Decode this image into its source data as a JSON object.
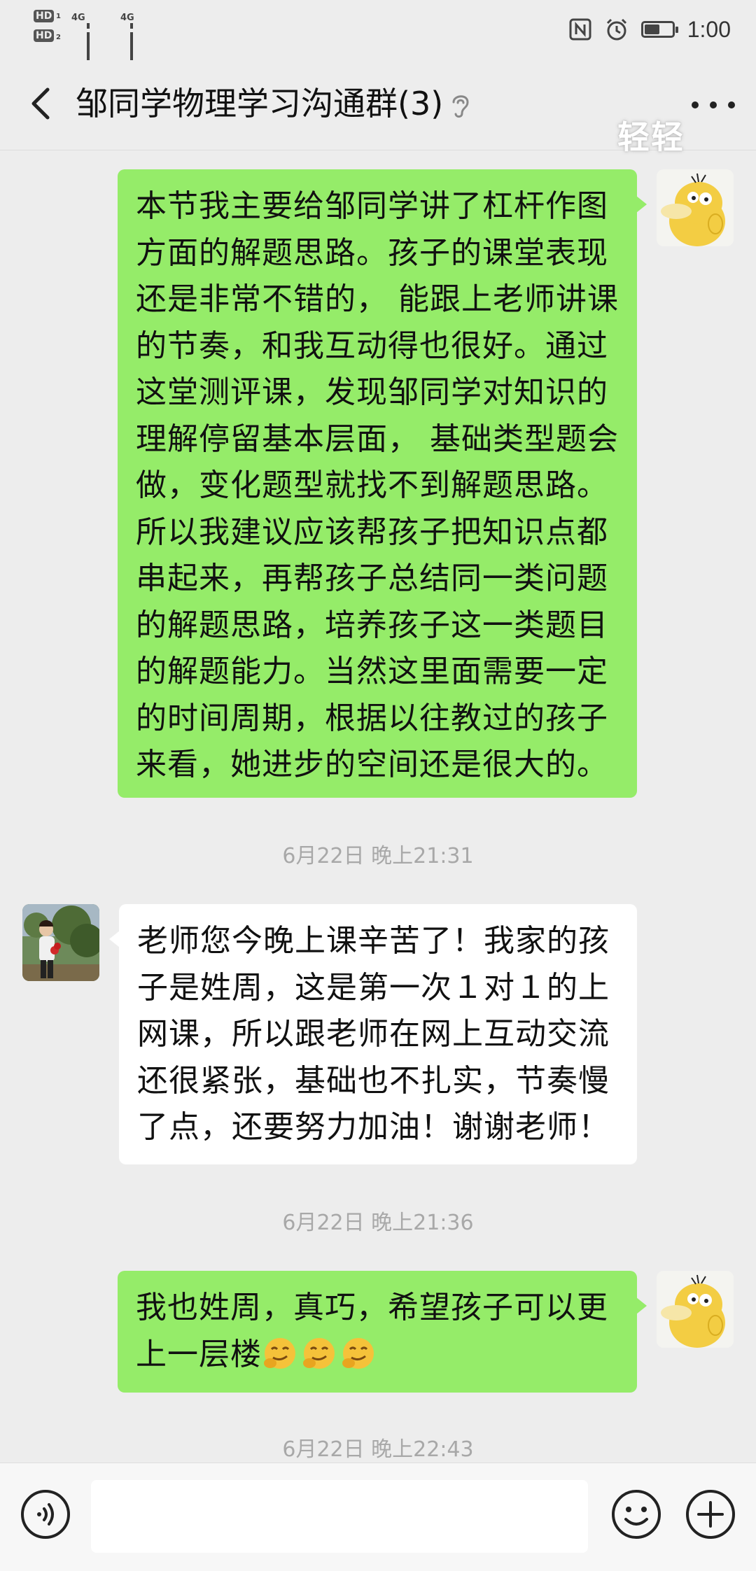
{
  "status_bar": {
    "sim1_badge": "HD",
    "sim1_index": "1",
    "sim2_badge": "HD",
    "sim2_index": "2",
    "net1": "4G",
    "net2": "4G",
    "time": "1:00",
    "battery_level": 0.55,
    "icons": [
      "nfc-icon",
      "alarm-icon",
      "battery-icon"
    ]
  },
  "header": {
    "title": "邹同学物理学习沟通群(3)",
    "icons": [
      "back-arrow-icon",
      "earpiece-icon",
      "more-dots-icon"
    ]
  },
  "watermark": "轻轻",
  "messages": [
    {
      "direction": "sent",
      "text": "本节我主要给邹同学讲了杠杆作图方面的解题思路。孩子的课堂表现还是非常不错的，  能跟上老师讲课的节奏，和我互动得也很好。通过这堂测评课，发现邹同学对知识的理解停留基本层面，  基础类型题会做，变化题型就找不到解题思路。所以我建议应该帮孩子把知识点都串起来，再帮孩子总结同一类问题的解题思路，培养孩子这一类题目的解题能力。当然这里面需要一定的时间周期，根据以往教过的孩子来看，她进步的空间还是很大的。",
      "avatar": "duck-avatar"
    },
    {
      "type": "timestamp",
      "text": "6月22日 晚上21:31"
    },
    {
      "direction": "received",
      "text": "老师您今晚上课辛苦了！我家的孩子是姓周，这是第一次１对１的上网课，所以跟老师在网上互动交流还很紧张，基础也不扎实，节奏慢了点，还要努力加油！谢谢老师！",
      "avatar": "parent-photo-avatar"
    },
    {
      "type": "timestamp",
      "text": "6月22日 晚上21:36"
    },
    {
      "direction": "sent",
      "text": "我也姓周，真巧，希望孩子可以更上一层楼",
      "emojis": [
        "smirk-emoji",
        "smirk-emoji",
        "smirk-emoji"
      ],
      "avatar": "duck-avatar"
    },
    {
      "type": "timestamp",
      "text": "6月22日 晚上22:43"
    }
  ],
  "input_bar": {
    "placeholder": "",
    "icons": [
      "voice-icon",
      "emoji-face-icon",
      "plus-icon"
    ]
  },
  "colors": {
    "background": "#ededed",
    "sent_bubble": "#95ec69",
    "received_bubble": "#ffffff",
    "timestamp": "#a8a8a8"
  }
}
